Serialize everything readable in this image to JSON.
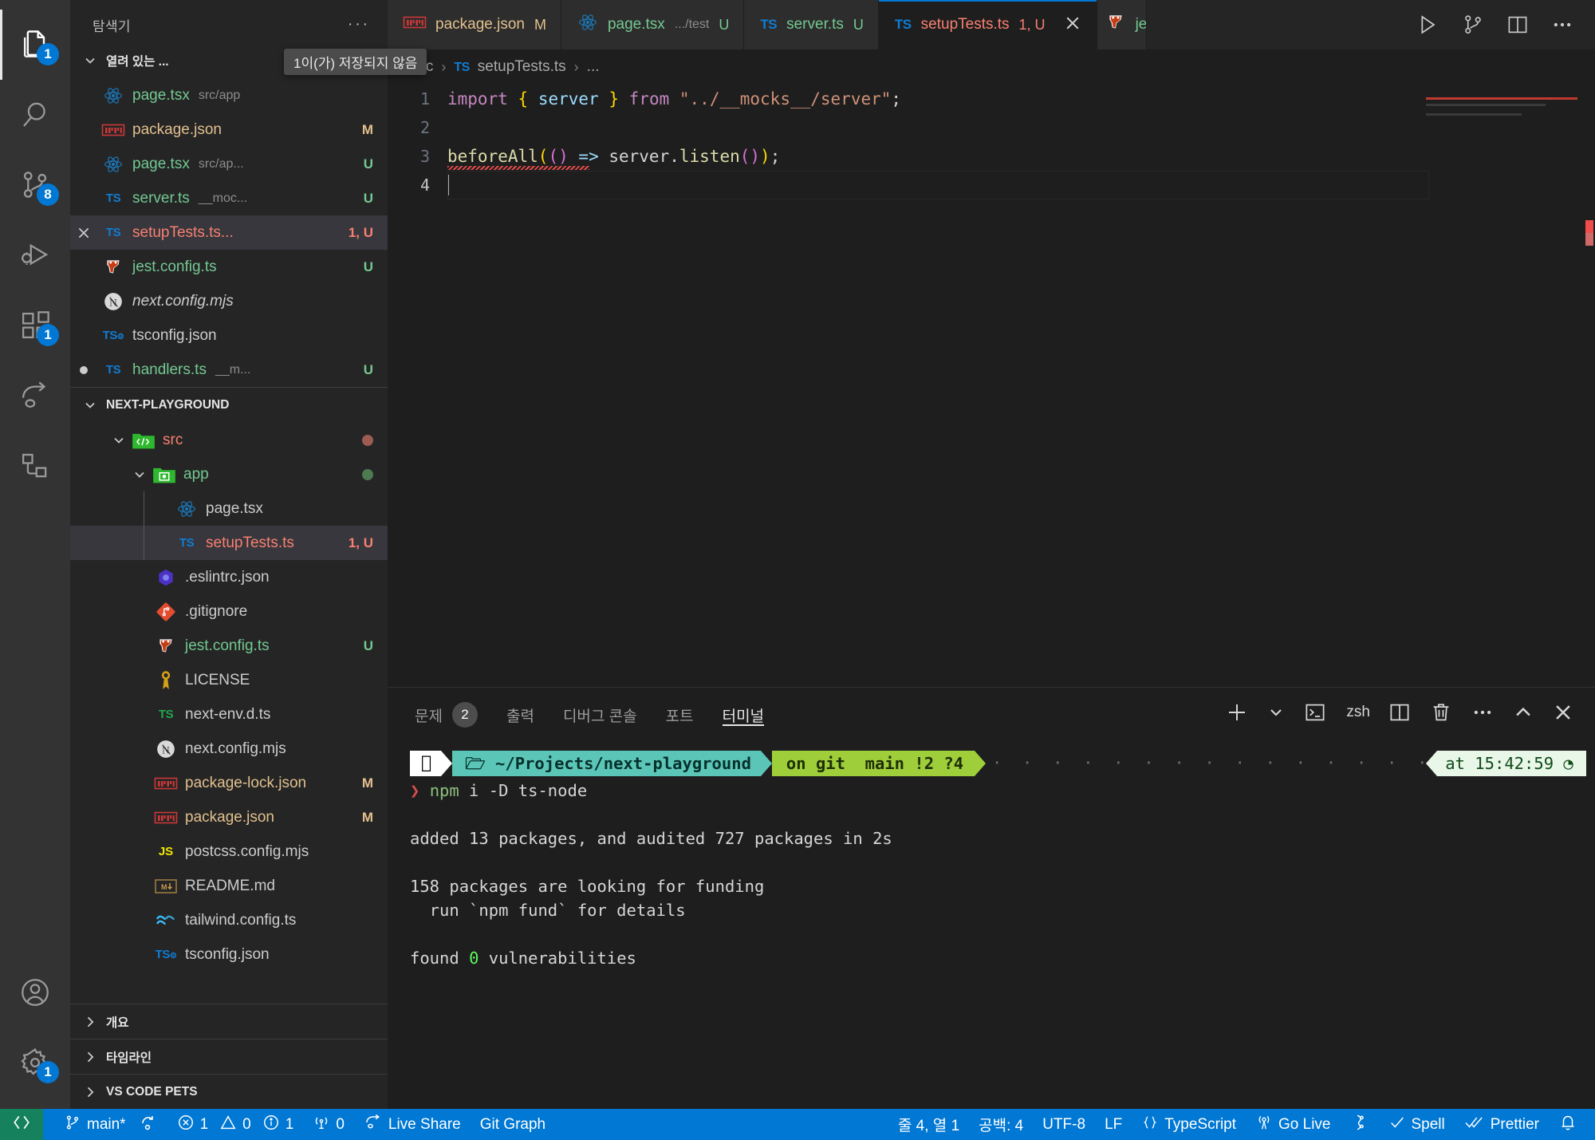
{
  "activitybar": {
    "items": [
      {
        "name": "explorer",
        "icon": "files-icon",
        "badge": "1",
        "active": true
      },
      {
        "name": "search",
        "icon": "search-icon",
        "badge": null,
        "active": false
      },
      {
        "name": "source-control",
        "icon": "source-control-icon",
        "badge": "8",
        "active": false
      },
      {
        "name": "run-and-debug",
        "icon": "run-debug-icon",
        "badge": null,
        "active": false
      },
      {
        "name": "extensions",
        "icon": "extensions-icon",
        "badge": "1",
        "active": false
      },
      {
        "name": "live-share",
        "icon": "live-share-icon",
        "badge": null,
        "active": false
      },
      {
        "name": "git-graph",
        "icon": "git-graph-icon",
        "badge": null,
        "active": false
      }
    ],
    "bottom": [
      {
        "name": "accounts",
        "icon": "account-icon",
        "badge": null
      },
      {
        "name": "manage",
        "icon": "gear-icon",
        "badge": "1"
      }
    ]
  },
  "sidebar": {
    "title": "탐색기",
    "more_label": "···",
    "open_editors": {
      "label": "열려 있는 ...",
      "unsaved_tooltip": "1이(가) 저장되지 않음",
      "items": [
        {
          "icon": "react-icon",
          "name": "page.tsx",
          "desc": "src/app",
          "badge": "",
          "color": "green"
        },
        {
          "icon": "npm-icon",
          "name": "package.json",
          "desc": "",
          "badge": "M",
          "color": "orange"
        },
        {
          "icon": "react-icon",
          "name": "page.tsx",
          "desc": "src/ap...",
          "badge": "U",
          "color": "green"
        },
        {
          "icon": "ts-icon",
          "name": "server.ts",
          "desc": "__moc...",
          "badge": "U",
          "color": "green"
        },
        {
          "icon": "ts-icon",
          "name": "setupTests.ts...",
          "desc": "",
          "badge": "1, U",
          "color": "red",
          "selected": true,
          "close": true
        },
        {
          "icon": "jest-icon",
          "name": "jest.config.ts",
          "desc": "",
          "badge": "U",
          "color": "green"
        },
        {
          "icon": "next-icon",
          "name": "next.config.mjs",
          "desc": "",
          "badge": "",
          "color": "white",
          "italic": true
        },
        {
          "icon": "tsconfig-icon",
          "name": "tsconfig.json",
          "desc": "",
          "badge": "",
          "color": "white"
        },
        {
          "icon": "ts-icon",
          "name": "handlers.ts",
          "desc": "__m...",
          "badge": "U",
          "color": "green",
          "dirty": true
        }
      ]
    },
    "project": {
      "label": "NEXT-PLAYGROUND",
      "items": [
        {
          "icon": "folder-src-icon",
          "name": "src",
          "badge": "",
          "color": "red",
          "indent": 1,
          "expanded": true,
          "dot": "#9d5c52"
        },
        {
          "icon": "folder-app-icon",
          "name": "app",
          "badge": "",
          "color": "green",
          "indent": 2,
          "expanded": true,
          "dot": "#4e7a52"
        },
        {
          "icon": "react-icon",
          "name": "page.tsx",
          "badge": "",
          "color": "white",
          "indent": 3
        },
        {
          "icon": "ts-icon",
          "name": "setupTests.ts",
          "badge": "1, U",
          "color": "red",
          "indent": 3,
          "selected": true
        },
        {
          "icon": "eslint-icon",
          "name": ".eslintrc.json",
          "badge": "",
          "color": "white",
          "indent": 2
        },
        {
          "icon": "git-icon",
          "name": ".gitignore",
          "badge": "",
          "color": "white",
          "indent": 2
        },
        {
          "icon": "jest-icon",
          "name": "jest.config.ts",
          "badge": "U",
          "color": "green",
          "indent": 2
        },
        {
          "icon": "license-icon",
          "name": "LICENSE",
          "badge": "",
          "color": "white",
          "indent": 2
        },
        {
          "icon": "ts-green-icon",
          "name": "next-env.d.ts",
          "badge": "",
          "color": "white",
          "indent": 2
        },
        {
          "icon": "next-icon",
          "name": "next.config.mjs",
          "badge": "",
          "color": "white",
          "indent": 2
        },
        {
          "icon": "npm-icon",
          "name": "package-lock.json",
          "badge": "M",
          "color": "orange",
          "indent": 2
        },
        {
          "icon": "npm-icon",
          "name": "package.json",
          "badge": "M",
          "color": "orange",
          "indent": 2
        },
        {
          "icon": "js-icon",
          "name": "postcss.config.mjs",
          "badge": "",
          "color": "white",
          "indent": 2
        },
        {
          "icon": "markdown-icon",
          "name": "README.md",
          "badge": "",
          "color": "white",
          "indent": 2
        },
        {
          "icon": "tailwind-icon",
          "name": "tailwind.config.ts",
          "badge": "",
          "color": "white",
          "indent": 2
        },
        {
          "icon": "tsconfig-icon",
          "name": "tsconfig.json",
          "badge": "",
          "color": "white",
          "indent": 2
        }
      ]
    },
    "collapsed_sections": [
      {
        "label": "개요"
      },
      {
        "label": "타임라인"
      },
      {
        "label": "VS CODE PETS"
      }
    ]
  },
  "tabs": [
    {
      "icon": "npm-icon",
      "label": "package.json",
      "desc": "",
      "badge": "M",
      "color": "orange",
      "active": false
    },
    {
      "icon": "react-icon",
      "label": "page.tsx",
      "desc": ".../test",
      "badge": "U",
      "color": "green",
      "active": false
    },
    {
      "icon": "ts-icon",
      "label": "server.ts",
      "desc": "",
      "badge": "U",
      "color": "green",
      "active": false
    },
    {
      "icon": "ts-icon",
      "label": "setupTests.ts",
      "desc": "",
      "badge": "1, U",
      "color": "red",
      "active": true,
      "close": true
    },
    {
      "icon": "jest-icon",
      "label": "je",
      "desc": "",
      "badge": "",
      "color": "green",
      "active": false,
      "clipped": true
    }
  ],
  "tab_actions": [
    {
      "name": "run-file-button",
      "icon": "play-icon"
    },
    {
      "name": "source-control-button",
      "icon": "source-control-icon"
    },
    {
      "name": "split-editor-button",
      "icon": "split-editor-icon"
    },
    {
      "name": "more-actions-button",
      "icon": "ellipsis-icon"
    }
  ],
  "breadcrumb": {
    "parts": [
      "src",
      "setupTests.ts",
      "..."
    ],
    "file_icon": "ts-icon"
  },
  "editor": {
    "lines": [
      {
        "no": "1",
        "tokens": [
          {
            "t": "import",
            "c": "purple"
          },
          {
            "t": " ",
            "c": "white"
          },
          {
            "t": "{",
            "c": "brace"
          },
          {
            "t": " ",
            "c": "white"
          },
          {
            "t": "server",
            "c": "blue"
          },
          {
            "t": " ",
            "c": "white"
          },
          {
            "t": "}",
            "c": "brace"
          },
          {
            "t": " ",
            "c": "white"
          },
          {
            "t": "from",
            "c": "purple"
          },
          {
            "t": " ",
            "c": "white"
          },
          {
            "t": "\"../__mocks__/server\"",
            "c": "orange"
          },
          {
            "t": ";",
            "c": "white"
          }
        ]
      },
      {
        "no": "2",
        "tokens": []
      },
      {
        "no": "3",
        "tokens": [
          {
            "t": "beforeAll",
            "c": "yellow"
          },
          {
            "t": "(",
            "c": "brace"
          },
          {
            "t": "(",
            "c": "brace2"
          },
          {
            "t": ")",
            "c": "brace2"
          },
          {
            "t": " ",
            "c": "white"
          },
          {
            "t": "=>",
            "c": "blue"
          },
          {
            "t": " ",
            "c": "white"
          },
          {
            "t": "server",
            "c": "white"
          },
          {
            "t": ".",
            "c": "white"
          },
          {
            "t": "listen",
            "c": "yellow"
          },
          {
            "t": "(",
            "c": "brace2"
          },
          {
            "t": ")",
            "c": "brace2"
          },
          {
            "t": ")",
            "c": "brace"
          },
          {
            "t": ";",
            "c": "white"
          }
        ],
        "squiggle": true
      },
      {
        "no": "4",
        "tokens": [],
        "current": true,
        "caret": true
      }
    ]
  },
  "panel": {
    "tabs": [
      {
        "label": "문제",
        "count": "2",
        "active": false
      },
      {
        "label": "출력",
        "count": null,
        "active": false
      },
      {
        "label": "디버그 콘솔",
        "count": null,
        "active": false
      },
      {
        "label": "포트",
        "count": null,
        "active": false
      },
      {
        "label": "터미널",
        "count": null,
        "active": true
      }
    ],
    "shell_label": "zsh",
    "actions": [
      {
        "name": "new-terminal-button",
        "icon": "plus-icon"
      },
      {
        "name": "terminal-dropdown-button",
        "icon": "chevron-down-icon"
      },
      {
        "name": "terminal-profile-button",
        "icon": "terminal-icon"
      },
      {
        "name": "split-terminal-button",
        "icon": "split-icon"
      },
      {
        "name": "kill-terminal-button",
        "icon": "trash-icon"
      },
      {
        "name": "panel-more-button",
        "icon": "ellipsis-icon"
      },
      {
        "name": "maximize-panel-button",
        "icon": "chevron-up-icon"
      },
      {
        "name": "close-panel-button",
        "icon": "close-icon"
      }
    ],
    "terminal": {
      "prompt": {
        "apple": "",
        "path": "~/Projects/next-playground",
        "path_prefix": "🖿 ",
        "path_bold": "next-playground",
        "path_plain": "~/Projects/",
        "git": "on git  main !2 ?4",
        "git_on": "on",
        "git_label": "git",
        "git_branch": "main !2 ?4",
        "time": "at 15:42:59 ◔"
      },
      "command_marker": "❯",
      "command_npm": "npm",
      "command_rest": " i -D ts-node",
      "output": [
        "added 13 packages, and audited 727 packages in 2s",
        "",
        "158 packages are looking for funding",
        "  run `npm fund` for details",
        "",
        "found 0 vulnerabilities"
      ],
      "found_prefix": "found ",
      "found_zero": "0",
      "found_suffix": " vulnerabilities"
    }
  },
  "statusbar": {
    "remote_icon": "remote-icon",
    "branch": "main*",
    "sync_icon": "sync-icon",
    "errors": "1",
    "warnings": "0",
    "infos": "1",
    "radio_tower_count": "0",
    "live_share": "Live Share",
    "git_graph": "Git Graph",
    "position": "줄 4, 열 1",
    "spaces": "공백: 4",
    "encoding": "UTF-8",
    "eol": "LF",
    "language": "TypeScript",
    "go_live": "Go Live",
    "spell": "Spell",
    "prettier": "Prettier",
    "bell_icon": "bell-icon"
  },
  "colors": {
    "accent": "#0078d4",
    "remote_green": "#16825d",
    "error_red": "#f88070",
    "modified_orange": "#e2c08d",
    "untracked_green": "#73c991"
  }
}
